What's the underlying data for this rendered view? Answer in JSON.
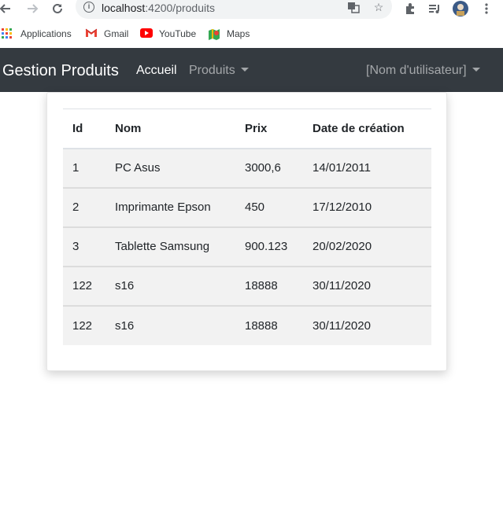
{
  "browser": {
    "url_host": "localhost",
    "url_path": ":4200/produits",
    "bookmarks": [
      "Applications",
      "Gmail",
      "YouTube",
      "Maps"
    ]
  },
  "navbar": {
    "brand": "Gestion Produits",
    "home": "Accueil",
    "products": "Produits",
    "user": "[Nom d'utilisateur]"
  },
  "table": {
    "headers": [
      "Id",
      "Nom",
      "Prix",
      "Date de création"
    ],
    "rows": [
      [
        "1",
        "PC Asus",
        "3000,6",
        "14/01/2011"
      ],
      [
        "2",
        "Imprimante Epson",
        "450",
        "17/12/2010"
      ],
      [
        "3",
        "Tablette Samsung",
        "900.123",
        "20/02/2020"
      ],
      [
        "122",
        "s16",
        "18888",
        "30/11/2020"
      ],
      [
        "122",
        "s16",
        "18888",
        "30/11/2020"
      ]
    ]
  },
  "colors": {
    "navbar_bg": "#343a40",
    "row_bg": "#f2f2f2"
  }
}
